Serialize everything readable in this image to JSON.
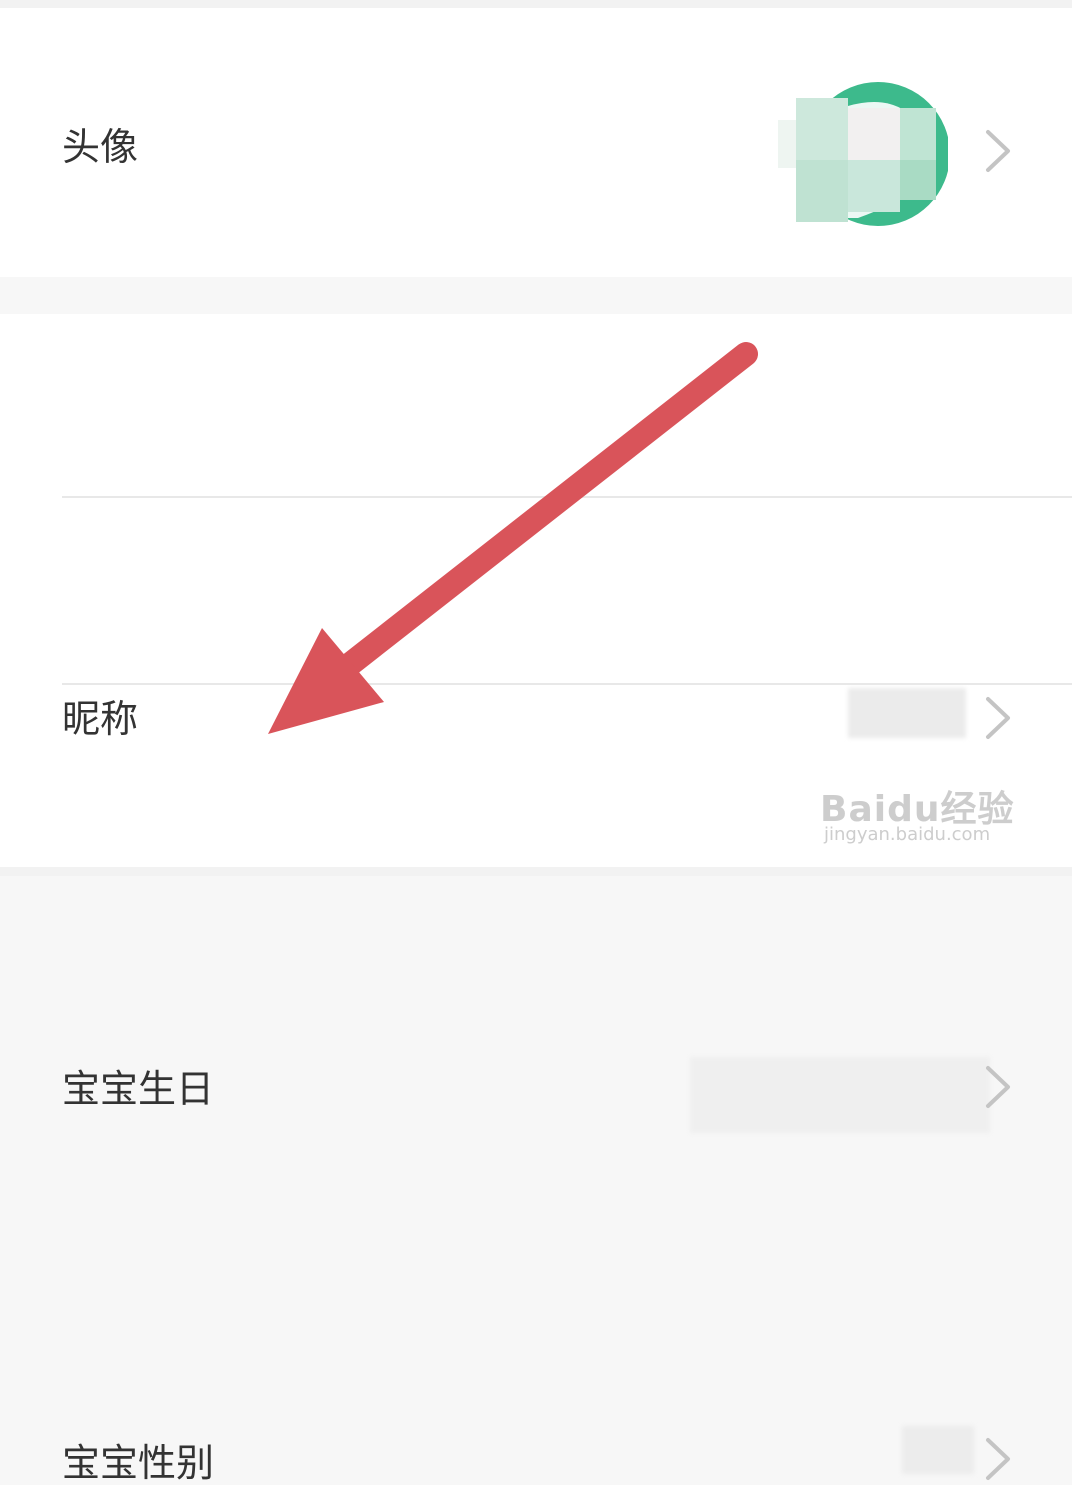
{
  "profile": {
    "avatar": {
      "label": "头像",
      "accent_color": "#3dba8c"
    },
    "rows": [
      {
        "label": "昵称"
      },
      {
        "label": "宝宝生日"
      },
      {
        "label": "宝宝性别"
      }
    ]
  },
  "annotation": {
    "arrow_color": "#d9545a"
  },
  "watermark": {
    "brand": "Baidu经验",
    "url": "jingyan.baidu.com"
  },
  "icons": {
    "row_chevron": "chevron-right-icon"
  }
}
